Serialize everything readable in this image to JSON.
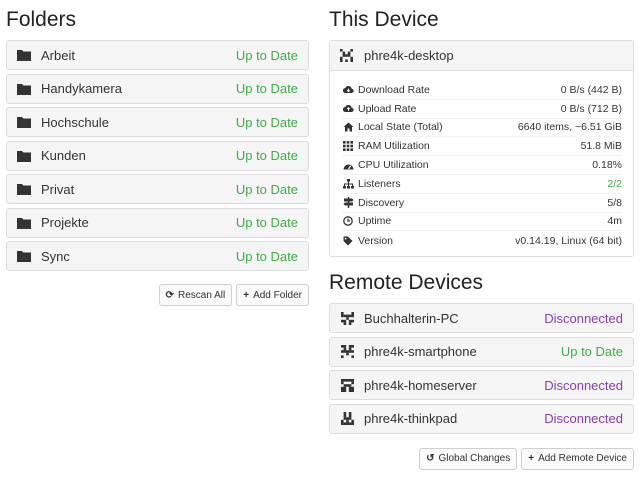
{
  "folders_section": {
    "title": "Folders",
    "items": [
      {
        "name": "Arbeit",
        "status": "Up to Date"
      },
      {
        "name": "Handykamera",
        "status": "Up to Date"
      },
      {
        "name": "Hochschule",
        "status": "Up to Date"
      },
      {
        "name": "Kunden",
        "status": "Up to Date"
      },
      {
        "name": "Privat",
        "status": "Up to Date"
      },
      {
        "name": "Projekte",
        "status": "Up to Date"
      },
      {
        "name": "Sync",
        "status": "Up to Date"
      }
    ],
    "rescan_label": "Rescan All",
    "add_folder_label": "Add Folder"
  },
  "this_device": {
    "title": "This Device",
    "name": "phre4k-desktop",
    "stats": [
      {
        "icon": "cloud-download-icon",
        "label": "Download Rate",
        "value": "0 B/s (442 B)"
      },
      {
        "icon": "cloud-upload-icon",
        "label": "Upload Rate",
        "value": "0 B/s (712 B)"
      },
      {
        "icon": "home-icon",
        "label": "Local State (Total)",
        "value": "6640 items, ~6.51 GiB"
      },
      {
        "icon": "memory-icon",
        "label": "RAM Utilization",
        "value": "51.8 MiB"
      },
      {
        "icon": "tachometer-icon",
        "label": "CPU Utilization",
        "value": "0.18%"
      },
      {
        "icon": "sitemap-icon",
        "label": "Listeners",
        "value": "2/2"
      },
      {
        "icon": "signpost-icon",
        "label": "Discovery",
        "value": "5/8"
      },
      {
        "icon": "clock-icon",
        "label": "Uptime",
        "value": "4m"
      },
      {
        "icon": "tag-icon",
        "label": "Version",
        "value": "v0.14.19, Linux (64 bit)"
      }
    ]
  },
  "remote_devices": {
    "title": "Remote Devices",
    "items": [
      {
        "name": "Buchhalterin-PC",
        "status": "Disconnected"
      },
      {
        "name": "phre4k-smartphone",
        "status": "Up to Date"
      },
      {
        "name": "phre4k-homeserver",
        "status": "Disconnected"
      },
      {
        "name": "phre4k-thinkpad",
        "status": "Disconnected"
      }
    ],
    "global_changes_label": "Global Changes",
    "add_device_label": "Add Remote Device"
  },
  "colors": {
    "up_to_date": "#3fad46",
    "disconnected": "#8a3eb0",
    "panel_bg": "#f5f5f5"
  }
}
